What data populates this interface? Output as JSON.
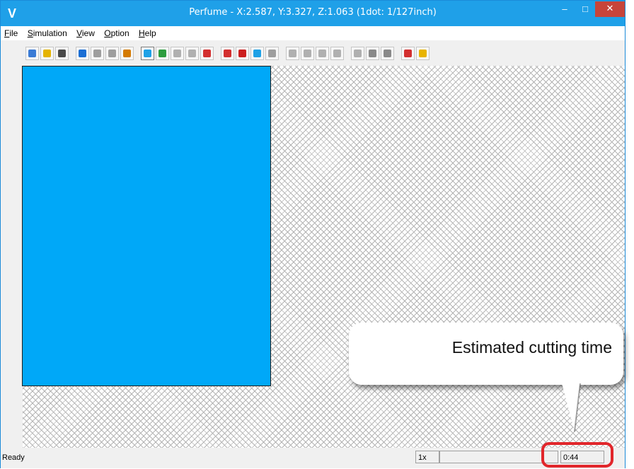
{
  "window": {
    "title": "Perfume - X:2.587, Y:3.327, Z:1.063 (1dot: 1/127inch)",
    "app_icon": "V",
    "minimize_glyph": "–",
    "maximize_glyph": "□",
    "close_glyph": "✕"
  },
  "menu": [
    {
      "label": "File",
      "mnemonic": "F"
    },
    {
      "label": "Simulation",
      "mnemonic": "S"
    },
    {
      "label": "View",
      "mnemonic": "V"
    },
    {
      "label": "Option",
      "mnemonic": "O"
    },
    {
      "label": "Help",
      "mnemonic": "H"
    }
  ],
  "toolbar": {
    "groups": [
      [
        {
          "icon": "new-file-icon",
          "color": "#3a7bd5"
        },
        {
          "icon": "open-folder-icon",
          "color": "#e5b400"
        },
        {
          "icon": "save-icon",
          "color": "#4a4a4a"
        }
      ],
      [
        {
          "icon": "reset-icon",
          "color": "#1c6fd4"
        },
        {
          "icon": "stop-icon",
          "color": "#9e9e9e"
        },
        {
          "icon": "play-icon",
          "color": "#9e9e9e"
        },
        {
          "icon": "stopwatch-icon",
          "color": "#d47a00"
        }
      ],
      [
        {
          "icon": "view-top-icon",
          "color": "#1ea1e6",
          "pressed": true
        },
        {
          "icon": "view-iso-icon",
          "color": "#2e9d3f"
        },
        {
          "icon": "path-curve-icon",
          "color": "#b0b0b0"
        },
        {
          "icon": "path-diagonal-icon",
          "color": "#b0b0b0"
        },
        {
          "icon": "view-3d-icon",
          "color": "#d32f2f"
        }
      ],
      [
        {
          "icon": "move-arrow-icon",
          "color": "#d32f2f"
        },
        {
          "icon": "color-fill-icon",
          "color": "#cc1f1f"
        },
        {
          "icon": "frame-icon",
          "color": "#1ea1e6"
        },
        {
          "icon": "sphere-icon",
          "color": "#9e9e9e"
        }
      ],
      [
        {
          "icon": "tool-icon-1",
          "color": "#b0b0b0"
        },
        {
          "icon": "tool-icon-2",
          "color": "#b0b0b0"
        },
        {
          "icon": "tool-icon-3",
          "color": "#b0b0b0"
        },
        {
          "icon": "tool-icon-4",
          "color": "#b0b0b0"
        }
      ],
      [
        {
          "icon": "light-1-icon",
          "color": "#b0b0b0"
        },
        {
          "icon": "light-2-icon",
          "color": "#8a8a8a"
        },
        {
          "icon": "light-3-icon",
          "color": "#8a8a8a"
        }
      ],
      [
        {
          "icon": "erase-icon",
          "color": "#d32f2f"
        },
        {
          "icon": "sparkle-icon",
          "color": "#e8b400"
        }
      ]
    ]
  },
  "canvas": {
    "workpiece_color": "#00a8f8"
  },
  "status": {
    "ready": "Ready",
    "zoom": "1x",
    "blank": "",
    "time": "0:44"
  },
  "callout": {
    "text": "Estimated cutting time"
  },
  "colors": {
    "title_bar": "#1fa0e8",
    "highlight_ring": "#e1262b"
  }
}
